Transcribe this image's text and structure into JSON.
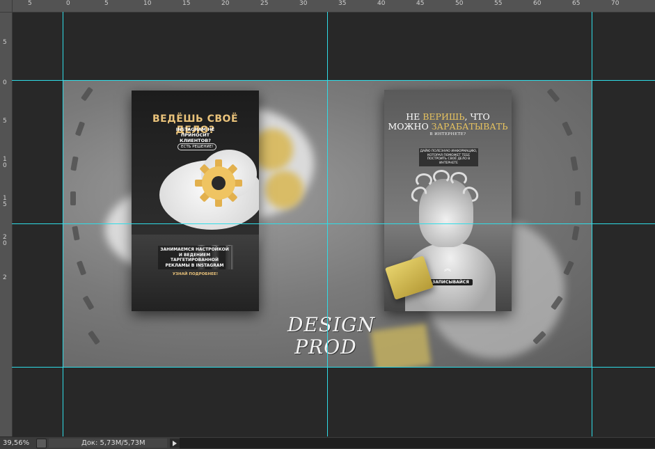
{
  "rulers": {
    "top_labels": [
      "5",
      "0",
      "5",
      "10",
      "15",
      "20",
      "25",
      "30",
      "35",
      "40",
      "45",
      "50",
      "55",
      "60",
      "65",
      "70"
    ],
    "left_labels": [
      "0",
      "5",
      "0",
      "5",
      "1\n0",
      "1\n5",
      "2\n0",
      "2"
    ]
  },
  "artboard": {
    "card_left": {
      "title": "ВЕДЁШЬ СВОЁ ДЕЛО?",
      "subtitle": "INSTAGRAM НЕ ПРИНОСИТ КЛИЕНТОВ?",
      "pill": "ЕСТЬ РЕШЕНИЕ!",
      "body": "ЗАНИМАЕМСЯ НАСТРОЙКОЙ И ВЕДЕНИЕМ ТАРГЕТИРОВАННОЙ РЕКЛАМЫ В INSTAGRAM",
      "cta": "УЗНАЙ ПОДРОБНЕЕ!"
    },
    "card_right": {
      "title_line1_a": "НЕ ",
      "title_line1_gold": "ВЕРИШЬ",
      "title_line1_b": ", ЧТО",
      "title_line2_a": "МОЖНО ",
      "title_line2_gold": "ЗАРАБАТЫВАТЬ",
      "subtitle": "В ИНТЕРНЕТЕ?",
      "box": "ДАЙЮ ПОЛЕЗНУЮ ИНФОРМАЦИЮ, КОТОРАЯ ПОМОЖЕТ ТЕБЕ ПОСТРОИТЬ СВОЁ ДЕЛО В ИНТЕРНЕТЕ",
      "cta": "ЗАПИСЫВАЙСЯ"
    },
    "logo_line1": "DESIGN",
    "logo_line2": "PROD",
    "accent_gold": "#e7c35f",
    "guide_color": "#2fdde8"
  },
  "status_bar": {
    "zoom": "39,56%",
    "doc_info": "Док: 5,73M/5,73M"
  }
}
